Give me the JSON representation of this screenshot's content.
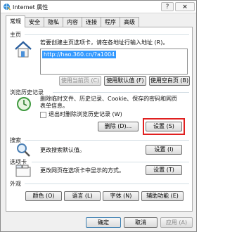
{
  "window": {
    "title": "Internet 属性",
    "help_label": "?",
    "close_label": "×"
  },
  "tabs": [
    {
      "label": "常规",
      "active": true
    },
    {
      "label": "安全"
    },
    {
      "label": "隐私"
    },
    {
      "label": "内容"
    },
    {
      "label": "连接"
    },
    {
      "label": "程序"
    },
    {
      "label": "高级"
    }
  ],
  "homepage": {
    "section_label": "主页",
    "description": "若要创建主页选项卡，请在各地址行输入地址 (R)。",
    "url": "http://hao.360.cn/?a1004",
    "use_current_label": "使用当前页 (C)",
    "use_default_label": "使用默认值 (F)",
    "use_blank_label": "使用空白页 (B)"
  },
  "history": {
    "section_label": "浏览历史记录",
    "description_line1": "删除临时文件、历史记录、Cookie、保存的密码和网页",
    "description_line2": "表单信息。",
    "delete_on_exit_label": "退出时删除浏览历史记录 (W)",
    "delete_label": "删除 (D)...",
    "settings_label": "设置 (S)"
  },
  "search": {
    "section_label": "搜索",
    "description": "更改搜索默认值。",
    "settings_label": "设置 (I)"
  },
  "tabs_section": {
    "section_label": "选项卡",
    "description": "更改网页在选项卡中显示的方式。",
    "settings_label": "设置 (T)"
  },
  "appearance": {
    "section_label": "外观",
    "colors_label": "颜色 (O)",
    "languages_label": "语言 (L)",
    "fonts_label": "字体 (N)",
    "accessibility_label": "辅助功能 (E)"
  },
  "footer": {
    "ok_label": "确定",
    "cancel_label": "取消",
    "apply_label": "应用 (A)"
  },
  "colors": {
    "highlight": "#e02020",
    "selection": "#3399ff"
  }
}
